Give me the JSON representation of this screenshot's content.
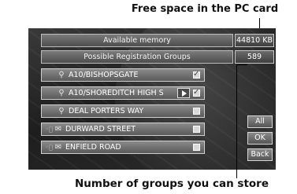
{
  "annotations": {
    "top": "Free space in the PC card",
    "bottom": "Number of groups you can store"
  },
  "memory": {
    "label": "Available memory",
    "value": "44810 KB"
  },
  "groups": {
    "label": "Possible Registration Groups",
    "value": "589"
  },
  "list": [
    {
      "label": "A10/BISHOPSGATE",
      "icon": "magnifier-icon",
      "checked": true
    },
    {
      "label": "A10/SHOREDITCH HIGH S",
      "icon": "magnifier-icon",
      "checked": true
    },
    {
      "label": "DEAL PORTERS WAY",
      "icon": "magnifier-icon",
      "checked": false
    },
    {
      "label": "DURWARD STREET",
      "icon": "ticket-icon",
      "checked": false
    },
    {
      "label": "ENFIELD ROAD",
      "icon": "ticket-icon",
      "checked": false
    }
  ],
  "buttons": {
    "all": "All",
    "ok": "OK",
    "back": "Back"
  }
}
